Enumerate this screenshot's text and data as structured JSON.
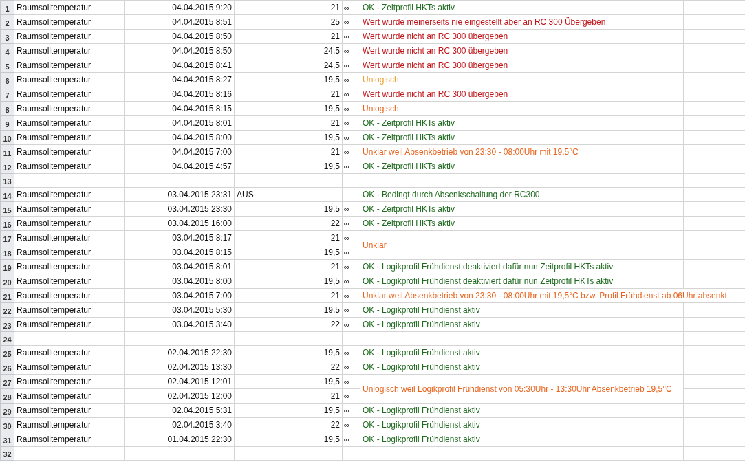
{
  "sheet": {
    "rows": [
      {
        "number": "1",
        "name": "Raumsolltemperatur",
        "datetime": "04.04.2015 9:20",
        "value": "21",
        "symbol": "∞",
        "note": {
          "text": "OK - Zeitprofil HKTs aktiv",
          "color": "#1f6a1f"
        }
      },
      {
        "number": "2",
        "name": "Raumsolltemperatur",
        "datetime": "04.04.2015 8:51",
        "value": "25",
        "symbol": "∞",
        "note": {
          "text": "Wert wurde meinerseits nie eingestellt aber an RC 300 Übergeben",
          "color": "#c01418"
        }
      },
      {
        "number": "3",
        "name": "Raumsolltemperatur",
        "datetime": "04.04.2015 8:50",
        "value": "21",
        "symbol": "∞",
        "note": {
          "text": "Wert wurde nicht an RC 300 übergeben",
          "color": "#c01418"
        }
      },
      {
        "number": "4",
        "name": "Raumsolltemperatur",
        "datetime": "04.04.2015 8:50",
        "value": "24,5",
        "symbol": "∞",
        "note": {
          "text": "Wert wurde nicht an RC 300 übergeben",
          "color": "#c01418"
        }
      },
      {
        "number": "5",
        "name": "Raumsolltemperatur",
        "datetime": "04.04.2015 8:41",
        "value": "24,5",
        "symbol": "∞",
        "note": {
          "text": "Wert wurde nicht an RC 300 übergeben",
          "color": "#c01418"
        }
      },
      {
        "number": "6",
        "name": "Raumsolltemperatur",
        "datetime": "04.04.2015 8:27",
        "value": "19,5",
        "symbol": "∞",
        "note": {
          "text": "Unlogisch",
          "color": "#eea030"
        }
      },
      {
        "number": "7",
        "name": "Raumsolltemperatur",
        "datetime": "04.04.2015 8:16",
        "value": "21",
        "symbol": "∞",
        "note": {
          "text": "Wert wurde nicht an RC 300 übergeben",
          "color": "#c01418"
        }
      },
      {
        "number": "8",
        "name": "Raumsolltemperatur",
        "datetime": "04.04.2015 8:15",
        "value": "19,5",
        "symbol": "∞",
        "note": {
          "text": "Unlogisch",
          "color": "#e8641e"
        }
      },
      {
        "number": "9",
        "name": "Raumsolltemperatur",
        "datetime": "04.04.2015 8:01",
        "value": "21",
        "symbol": "∞",
        "note": {
          "text": "OK - Zeitprofil HKTs aktiv",
          "color": "#1f6a1f"
        }
      },
      {
        "number": "10",
        "name": "Raumsolltemperatur",
        "datetime": "04.04.2015 8:00",
        "value": "19,5",
        "symbol": "∞",
        "note": {
          "text": "OK - Zeitprofil HKTs aktiv",
          "color": "#1f6a1f"
        }
      },
      {
        "number": "11",
        "name": "Raumsolltemperatur",
        "datetime": "04.04.2015 7:00",
        "value": "21",
        "symbol": "∞",
        "note": {
          "text": "Unklar weil Absenkbetrieb von 23:30 - 08:00Uhr mit 19,5°C",
          "color": "#e8641e"
        }
      },
      {
        "number": "12",
        "name": "Raumsolltemperatur",
        "datetime": "04.04.2015 4:57",
        "value": "19,5",
        "symbol": "∞",
        "note": {
          "text": "OK - Zeitprofil HKTs aktiv",
          "color": "#1f6a1f"
        }
      },
      {
        "number": "13"
      },
      {
        "number": "14",
        "name": "Raumsolltemperatur",
        "datetime": "03.04.2015 23:31",
        "value": "AUS",
        "value_is_text": true,
        "note": {
          "text": "OK - Bedingt durch Absenkschaltung der RC300",
          "color": "#1f6a1f"
        }
      },
      {
        "number": "15",
        "name": "Raumsolltemperatur",
        "datetime": "03.04.2015 23:30",
        "value": "19,5",
        "symbol": "∞",
        "note": {
          "text": "OK - Zeitprofil HKTs aktiv",
          "color": "#1f6a1f"
        }
      },
      {
        "number": "16",
        "name": "Raumsolltemperatur",
        "datetime": "03.04.2015 16:00",
        "value": "22",
        "symbol": "∞",
        "note": {
          "text": "OK - Zeitprofil HKTs aktiv",
          "color": "#1f6a1f"
        }
      },
      {
        "number": "17",
        "name": "Raumsolltemperatur",
        "datetime": "03.04.2015 8:17",
        "value": "21",
        "symbol": "∞",
        "note": {
          "text": "Unklar",
          "color": "#e8641e",
          "merged_with_next": true
        }
      },
      {
        "number": "18",
        "name": "Raumsolltemperatur",
        "datetime": "03.04.2015 8:15",
        "value": "19,5",
        "symbol": "∞"
      },
      {
        "number": "19",
        "name": "Raumsolltemperatur",
        "datetime": "03.04.2015 8:01",
        "value": "21",
        "symbol": "∞",
        "note": {
          "text": "OK - Logikprofil Frühdienst deaktiviert dafür nun Zeitprofil HKTs aktiv",
          "color": "#1f6a1f"
        }
      },
      {
        "number": "20",
        "name": "Raumsolltemperatur",
        "datetime": "03.04.2015 8:00",
        "value": "19,5",
        "symbol": "∞",
        "note": {
          "text": "OK - Logikprofil Frühdienst deaktiviert dafür nun Zeitprofil HKTs aktiv",
          "color": "#1f6a1f"
        }
      },
      {
        "number": "21",
        "name": "Raumsolltemperatur",
        "datetime": "03.04.2015 7:00",
        "value": "21",
        "symbol": "∞",
        "note": {
          "text": "Unklar weil Absenkbetrieb von 23:30 - 08:00Uhr mit 19,5°C bzw. Profil Frühdienst ab 06Uhr absenkt",
          "color": "#e8641e",
          "spills_right": true
        }
      },
      {
        "number": "22",
        "name": "Raumsolltemperatur",
        "datetime": "03.04.2015 5:30",
        "value": "19,5",
        "symbol": "∞",
        "note": {
          "text": "OK - Logikprofil Frühdienst aktiv",
          "color": "#1f6a1f"
        }
      },
      {
        "number": "23",
        "name": "Raumsolltemperatur",
        "datetime": "03.04.2015 3:40",
        "value": "22",
        "symbol": "∞",
        "note": {
          "text": "OK - Logikprofil Frühdienst aktiv",
          "color": "#1f6a1f"
        }
      },
      {
        "number": "24"
      },
      {
        "number": "25",
        "name": "Raumsolltemperatur",
        "datetime": "02.04.2015 22:30",
        "value": "19,5",
        "symbol": "∞",
        "note": {
          "text": "OK - Logikprofil Frühdienst aktiv",
          "color": "#1f6a1f"
        }
      },
      {
        "number": "26",
        "name": "Raumsolltemperatur",
        "datetime": "02.04.2015 13:30",
        "value": "22",
        "symbol": "∞",
        "note": {
          "text": "OK - Logikprofil Frühdienst aktiv",
          "color": "#1f6a1f"
        }
      },
      {
        "number": "27",
        "name": "Raumsolltemperatur",
        "datetime": "02.04.2015 12:01",
        "value": "19,5",
        "symbol": "∞",
        "note": {
          "text": "Unlogisch weil Logikprofil Frühdienst von 05:30Uhr - 13:30Uhr Absenkbetrieb 19,5°C",
          "color": "#e8641e",
          "merged_with_next": true
        }
      },
      {
        "number": "28",
        "name": "Raumsolltemperatur",
        "datetime": "02.04.2015 12:00",
        "value": "21",
        "symbol": "∞"
      },
      {
        "number": "29",
        "name": "Raumsolltemperatur",
        "datetime": "02.04.2015 5:31",
        "value": "19,5",
        "symbol": "∞",
        "note": {
          "text": "OK - Logikprofil Frühdienst aktiv",
          "color": "#1f6a1f"
        }
      },
      {
        "number": "30",
        "name": "Raumsolltemperatur",
        "datetime": "02.04.2015 3:40",
        "value": "22",
        "symbol": "∞",
        "note": {
          "text": "OK - Logikprofil Frühdienst aktiv",
          "color": "#1f6a1f"
        }
      },
      {
        "number": "31",
        "name": "Raumsolltemperatur",
        "datetime": "01.04.2015 22:30",
        "value": "19,5",
        "symbol": "∞",
        "note": {
          "text": "OK - Logikprofil Frühdienst aktiv",
          "color": "#1f6a1f"
        }
      },
      {
        "number": "32"
      }
    ]
  }
}
